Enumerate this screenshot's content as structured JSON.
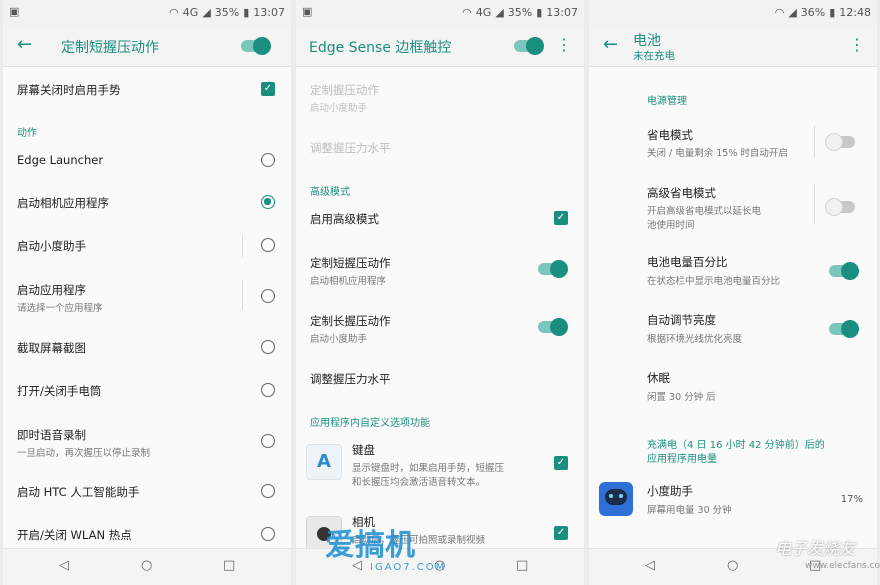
{
  "screen1": {
    "status": {
      "pct": "35%",
      "time": "13:07",
      "net": "4G"
    },
    "title": "定制短握压动作",
    "rows": {
      "screen_off": "屏幕关闭时启用手势",
      "section": "动作",
      "edge_launcher": "Edge Launcher",
      "camera": "启动相机应用程序",
      "xiaodu": "启动小度助手",
      "app": "启动应用程序",
      "app_sub": "请选择一个应用程序",
      "screenshot": "截取屏幕截图",
      "flashlight": "打开/关闭手电筒",
      "voice": "即时语音录制",
      "voice_sub": "一旦启动，再次握压以停止录制",
      "htc_ai": "启动 HTC 人工智能助手",
      "wlan": "开启/关闭 WLAN 热点"
    }
  },
  "screen2": {
    "status": {
      "pct": "35%",
      "time": "13:07",
      "net": "4G"
    },
    "title": "Edge Sense 边框触控",
    "rows": {
      "custom": "定制握压动作",
      "custom_sub": "启动小度助手",
      "adjust_dis": "调整握压力水平",
      "section_adv": "高级模式",
      "enable_adv": "启用高级模式",
      "short": "定制短握压动作",
      "short_sub": "启动相机应用程序",
      "long": "定制长握压动作",
      "long_sub": "启动小度助手",
      "adjust": "调整握压力水平",
      "section_app": "应用程序内自定义选项功能",
      "keyboard": "键盘",
      "keyboard_desc1": "显示键盘时，如果启用手势，短握压",
      "keyboard_desc2": "和长握压均会激活语音转文本。",
      "keyboard_icon": "A",
      "camera": "相机",
      "camera_sub": "启动后，握压可拍照或录制视频"
    }
  },
  "screen3": {
    "status": {
      "pct": "36%",
      "time": "12:48"
    },
    "title": "电池",
    "subtitle": "未在充电",
    "rows": {
      "section_power": "电源管理",
      "saver": "省电模式",
      "saver_sub": "关闭 / 电量剩余 15% 时自动开启",
      "extreme": "高级省电模式",
      "extreme_sub1": "开启高级省电模式以延长电",
      "extreme_sub2": "池使用时间",
      "percent": "电池电量百分比",
      "percent_sub": "在状态栏中显示电池电量百分比",
      "brightness": "自动调节亮度",
      "brightness_sub": "根据环境光线优化亮度",
      "sleep": "休眠",
      "sleep_sub": "闲置 30 分钟 后",
      "section_usage1": "充满电（4 日 16 小时 42 分钟前）后的",
      "section_usage2": "应用程序用电量",
      "xiaodu": "小度助手",
      "xiaodu_sub": "屏幕用电量 30 分钟",
      "xiaodu_pct": "17%"
    }
  },
  "watermark": {
    "text": "爱搞机",
    "url": "IGAO7.COM"
  },
  "watermark2": {
    "text": "电子发烧友",
    "url": "www.elecfans.com"
  },
  "colors": {
    "accent": "#1a8f80",
    "bg": "#fafafa"
  }
}
